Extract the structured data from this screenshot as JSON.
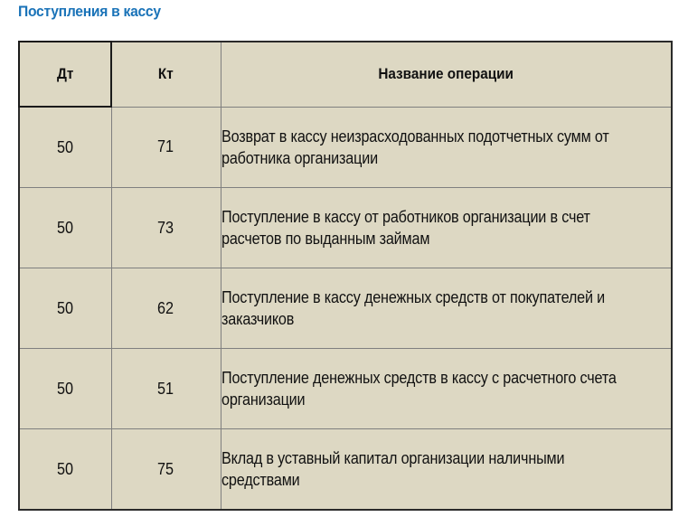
{
  "page": {
    "title": "Поступления в кассу",
    "title_color": "#1a73b8",
    "table_background": "#ddd8c3"
  },
  "table": {
    "headers": {
      "debit": "Дт",
      "credit": "Кт",
      "operation": "Название операции"
    },
    "rows": [
      {
        "debit": "50",
        "credit": "71",
        "line1": "Возврат в кассу неизрасходованных подотчетных сумм от",
        "line2": "работника организации"
      },
      {
        "debit": "50",
        "credit": "73",
        "line1": "Поступление в кассу от работников организации в счет",
        "line2": "расчетов по выданным займам"
      },
      {
        "debit": "50",
        "credit": "62",
        "line1": "Поступление в кассу денежных средств от покупателей и",
        "line2": "заказчиков"
      },
      {
        "debit": "50",
        "credit": "51",
        "line1": "Поступление денежных средств в кассу с расчетного счета",
        "line2": "организации"
      },
      {
        "debit": "50",
        "credit": "75",
        "line1": "Вклад в уставный капитал организации наличными",
        "line2": "средствами"
      }
    ]
  }
}
